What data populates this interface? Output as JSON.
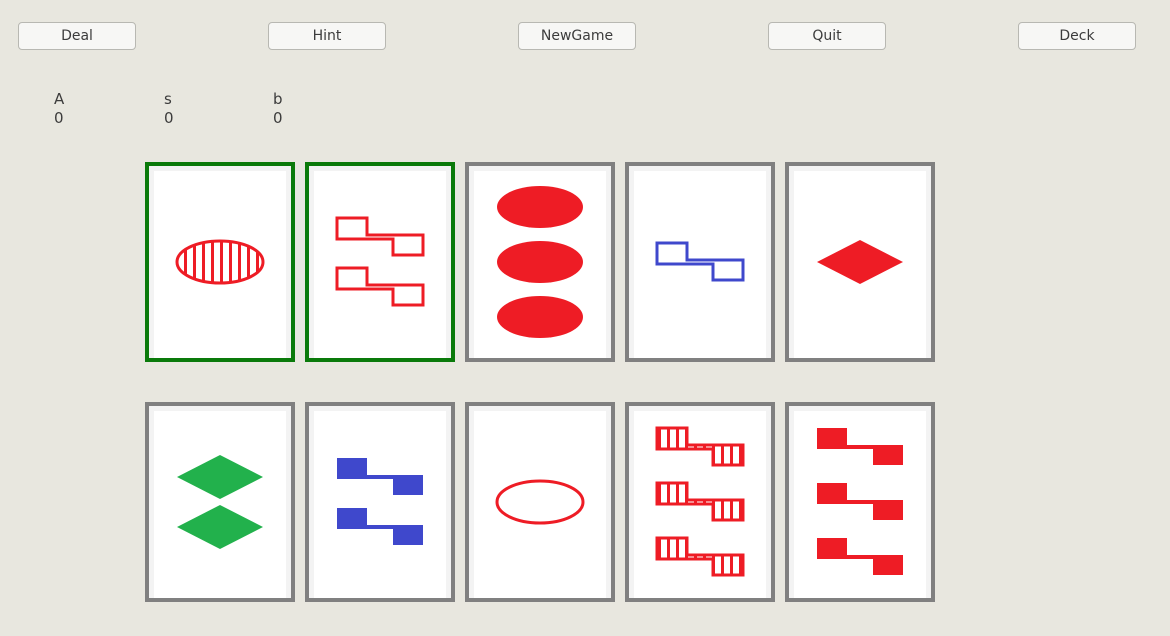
{
  "toolbar": {
    "deal_label": "Deal",
    "hint_label": "Hint",
    "newgame_label": "NewGame",
    "quit_label": "Quit",
    "deck_label": "Deck"
  },
  "scores": [
    {
      "label": "A",
      "value": "0"
    },
    {
      "label": "s",
      "value": "0"
    },
    {
      "label": "b",
      "value": "0"
    }
  ],
  "colors": {
    "red": "#ee1c25",
    "blue": "#3f48cc",
    "green": "#22b14c",
    "selected_border": "#0a7a0a",
    "card_border": "#808080"
  },
  "cards": [
    {
      "count": 1,
      "shape": "oval",
      "fill": "striped",
      "color": "red",
      "selected": true
    },
    {
      "count": 2,
      "shape": "squiggle",
      "fill": "empty",
      "color": "red",
      "selected": true
    },
    {
      "count": 3,
      "shape": "oval",
      "fill": "solid",
      "color": "red",
      "selected": false
    },
    {
      "count": 1,
      "shape": "squiggle",
      "fill": "empty",
      "color": "blue",
      "selected": false
    },
    {
      "count": 1,
      "shape": "diamond",
      "fill": "solid",
      "color": "red",
      "selected": false
    },
    {
      "count": 2,
      "shape": "diamond",
      "fill": "solid",
      "color": "green",
      "selected": false
    },
    {
      "count": 2,
      "shape": "squiggle",
      "fill": "solid",
      "color": "blue",
      "selected": false
    },
    {
      "count": 1,
      "shape": "oval",
      "fill": "empty",
      "color": "red",
      "selected": false
    },
    {
      "count": 3,
      "shape": "squiggle",
      "fill": "striped",
      "color": "red",
      "selected": false
    },
    {
      "count": 3,
      "shape": "squiggle",
      "fill": "solid",
      "color": "red",
      "selected": false
    }
  ]
}
